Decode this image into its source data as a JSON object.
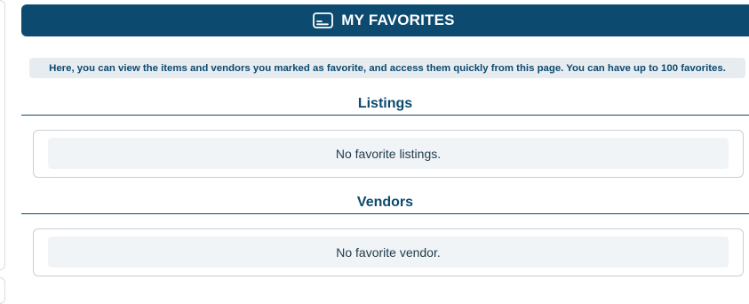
{
  "header": {
    "title": "MY FAVORITES",
    "icon": "id-card-icon",
    "background": "#0c4a70"
  },
  "notice": {
    "text": "Here, you can view the items and vendors you marked as favorite, and access them quickly from this page. You can have up to 100 favorites."
  },
  "sections": [
    {
      "title": "Listings",
      "empty_text": "No favorite listings."
    },
    {
      "title": "Vendors",
      "empty_text": "No favorite vendor."
    }
  ],
  "colors": {
    "accent": "#0c4a70",
    "notice_bg": "#e7ecf0",
    "empty_bg": "#f1f4f6"
  }
}
